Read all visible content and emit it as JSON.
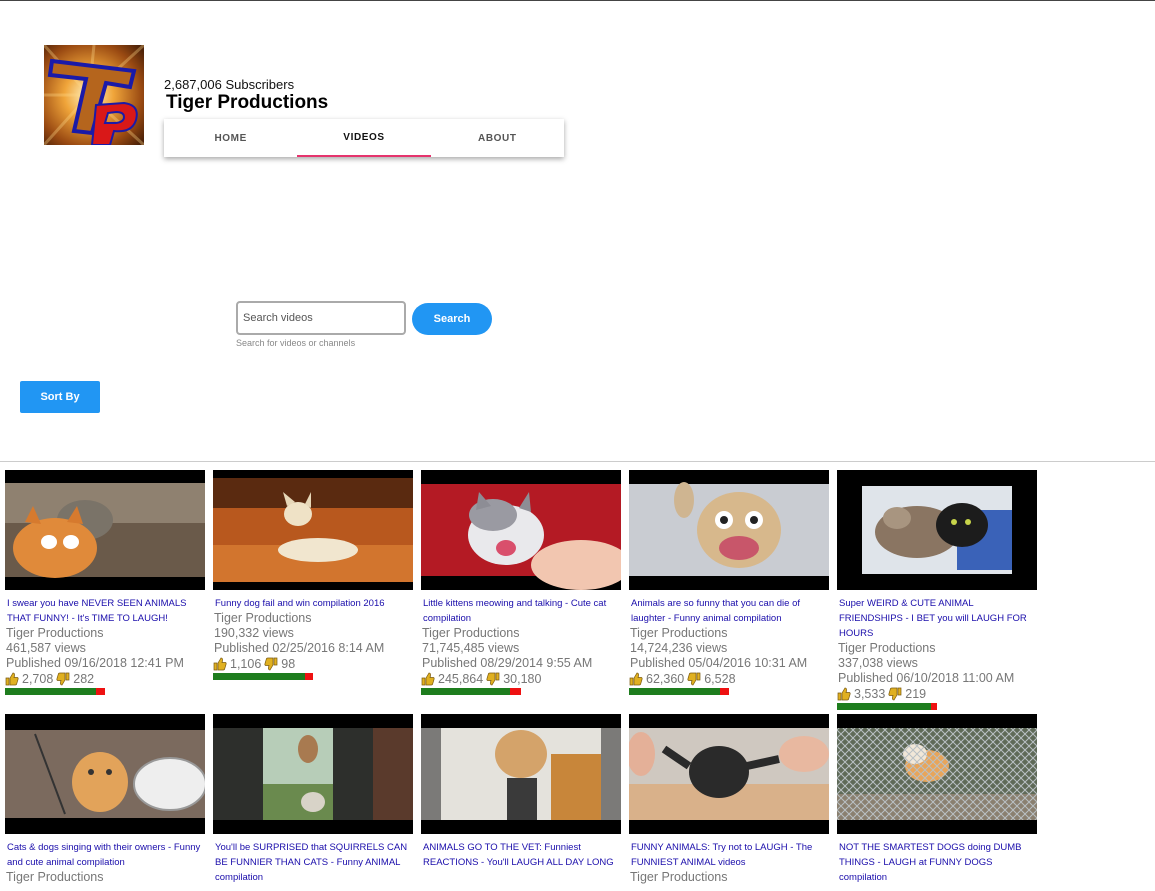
{
  "channel": {
    "subscribers": "2,687,006 Subscribers",
    "name": "Tiger Productions",
    "logo_letters": "TP"
  },
  "tabs": [
    {
      "label": "HOME",
      "active": false
    },
    {
      "label": "VIDEOS",
      "active": true
    },
    {
      "label": "ABOUT",
      "active": false
    }
  ],
  "search": {
    "placeholder": "Search videos",
    "button_label": "Search",
    "hint": "Search for videos or channels"
  },
  "sort_label": "Sort By",
  "colors": {
    "accent": "#2196f3",
    "tab_underline": "#e5336d",
    "link": "#1a0dab",
    "like_bar": "#1e7d1e",
    "dislike_bar": "#ee1111"
  },
  "videos": [
    {
      "title": "I swear you have NEVER SEEN ANIMALS THAT FUNNY! - It's TIME TO LAUGH!",
      "channel": "Tiger Productions",
      "views": "461,587 views",
      "published": "Published 09/16/2018 12:41 PM",
      "likes": "2,708",
      "dislikes": "282",
      "like_ratio": 0.906
    },
    {
      "title": "Funny dog fail and win compilation 2016",
      "channel": "Tiger Productions",
      "views": "190,332 views",
      "published": "Published 02/25/2016 8:14 AM",
      "likes": "1,106",
      "dislikes": "98",
      "like_ratio": 0.919
    },
    {
      "title": "Little kittens meowing and talking - Cute cat compilation",
      "channel": "Tiger Productions",
      "views": "71,745,485 views",
      "published": "Published 08/29/2014 9:55 AM",
      "likes": "245,864",
      "dislikes": "30,180",
      "like_ratio": 0.891
    },
    {
      "title": "Animals are so funny that you can die of laughter - Funny animal compilation",
      "channel": "Tiger Productions",
      "views": "14,724,236 views",
      "published": "Published 05/04/2016 10:31 AM",
      "likes": "62,360",
      "dislikes": "6,528",
      "like_ratio": 0.905
    },
    {
      "title": "Super WEIRD & CUTE ANIMAL FRIENDSHIPS - I BET you will LAUGH FOR HOURS",
      "channel": "Tiger Productions",
      "views": "337,038 views",
      "published": "Published 06/10/2018 11:00 AM",
      "likes": "3,533",
      "dislikes": "219",
      "like_ratio": 0.942
    },
    {
      "title": "Cats & dogs singing with their owners - Funny and cute animal compilation",
      "channel": "Tiger Productions"
    },
    {
      "title": "You'll be SURPRISED that SQUIRRELS CAN BE FUNNIER THAN CATS - Funny ANIMAL compilation",
      "channel": ""
    },
    {
      "title": "ANIMALS GO TO THE VET: Funniest REACTIONS - You'll LAUGH ALL DAY LONG",
      "channel": ""
    },
    {
      "title": "FUNNY ANIMALS: Try not to LAUGH - The FUNNIEST ANIMAL videos",
      "channel": "Tiger Productions"
    },
    {
      "title": "NOT THE SMARTEST DOGS doing DUMB THINGS - LAUGH at FUNNY DOGS compilation",
      "channel": ""
    }
  ]
}
